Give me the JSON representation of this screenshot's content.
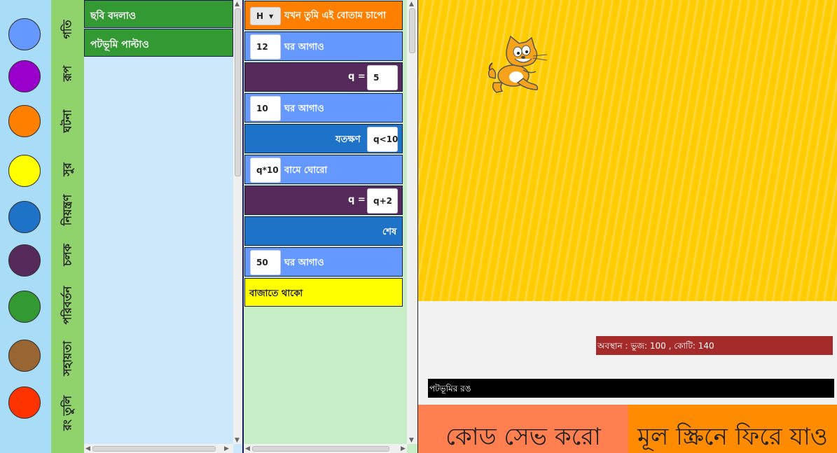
{
  "colors": {
    "motion": "#6699ff",
    "looks": "#9900cc",
    "events": "#ff8000",
    "sound": "#ffff00",
    "control": "#1e73c8",
    "variables": "#552a5a",
    "operators": "#339933",
    "help": "#996633",
    "paint": "#ff3300"
  },
  "categories": [
    "গতি",
    "রূপ",
    "ঘটনা",
    "সুর",
    "নিয়ন্ত্রণ",
    "চলক",
    "পরিবর্তন",
    "সহায়তা",
    "রং তুলি"
  ],
  "palette": {
    "blocks": [
      "ছবি বদলাও",
      "পটভূমি পাল্টাও"
    ]
  },
  "script": {
    "hat": {
      "key": "H",
      "label": "যখন তুমি এই বোতাম চাপো"
    },
    "move1": {
      "value": "12",
      "label": "ঘর আগাও"
    },
    "set1": {
      "var": "q =",
      "value": "5"
    },
    "move2": {
      "value": "10",
      "label": "ঘর আগাও"
    },
    "while": {
      "label": "যতক্ষণ",
      "cond": "q<10"
    },
    "turn": {
      "value": "q*10",
      "label": "বামে ঘোরো"
    },
    "set2": {
      "var": "q =",
      "value": "q+2"
    },
    "end": {
      "label": "শেষ"
    },
    "move3": {
      "value": "50",
      "label": "ঘর আগাও"
    },
    "sound": {
      "label": "বাজাতে থাকো"
    }
  },
  "stage": {
    "position_text": "অবস্থান : ভুজ: 100 , কোটি: 140",
    "background_color_label": "পটভূমির রঙ",
    "save_button": "কোড সেভ করো",
    "back_button": "মূল স্ক্রিনে ফিরে যাও"
  }
}
